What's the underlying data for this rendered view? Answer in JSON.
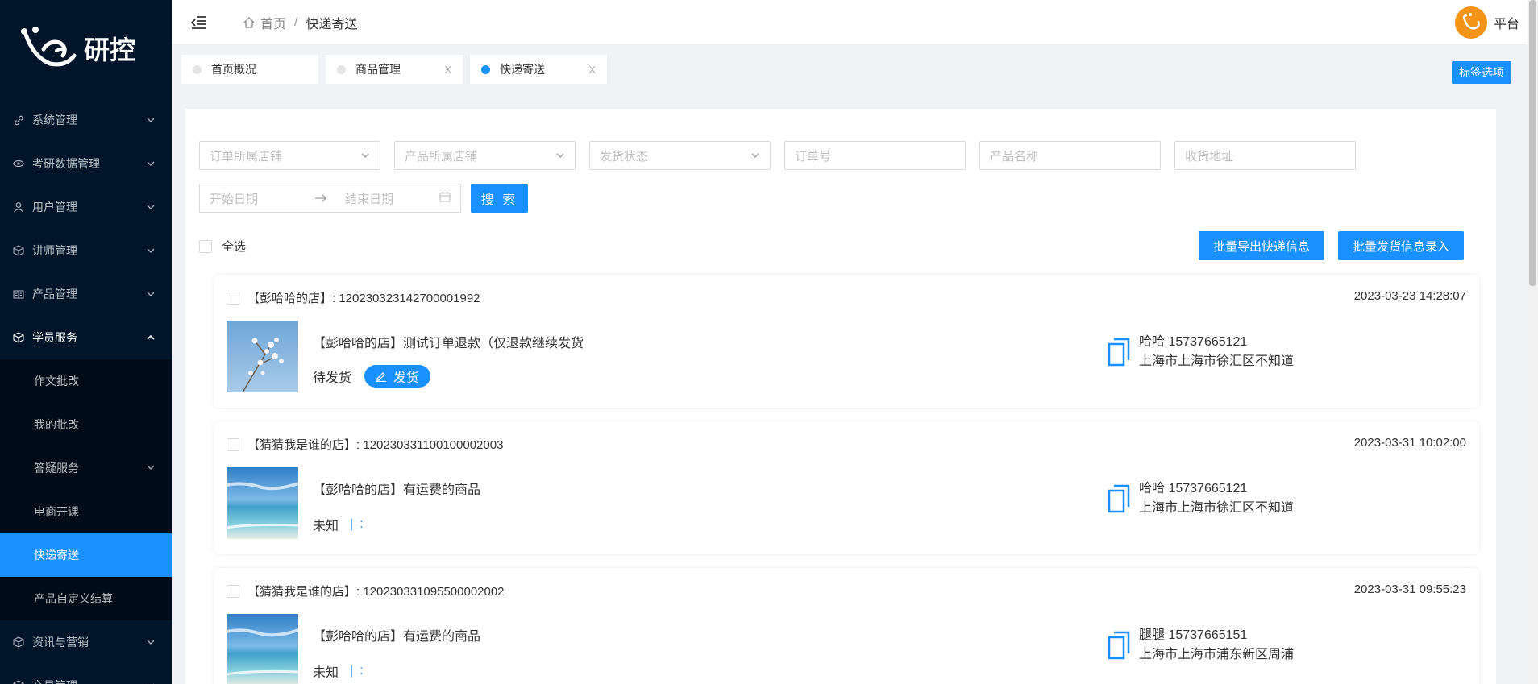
{
  "app": {
    "logo_text": "研控",
    "user_name": "平台"
  },
  "sidebar": {
    "items": [
      {
        "label": "系统管理",
        "icon": "link-icon"
      },
      {
        "label": "考研数据管理",
        "icon": "eye-icon"
      },
      {
        "label": "用户管理",
        "icon": "user-icon"
      },
      {
        "label": "讲师管理",
        "icon": "cube-icon"
      },
      {
        "label": "产品管理",
        "icon": "book-icon"
      },
      {
        "label": "学员服务",
        "icon": "cube-icon"
      }
    ],
    "sub_items": [
      {
        "label": "作文批改"
      },
      {
        "label": "我的批改"
      },
      {
        "label": "答疑服务"
      },
      {
        "label": "电商开课"
      },
      {
        "label": "快递寄送"
      },
      {
        "label": "产品自定义结算"
      }
    ],
    "after_items": [
      {
        "label": "资讯与营销"
      },
      {
        "label": "交易管理"
      }
    ]
  },
  "header": {
    "breadcrumb_home": "首页",
    "breadcrumb_sep": "/",
    "breadcrumb_current": "快递寄送"
  },
  "tags": [
    {
      "label": "首页概况"
    },
    {
      "label": "商品管理",
      "close": "X"
    },
    {
      "label": "快递寄送",
      "close": "X"
    }
  ],
  "tags_option": "标签选项",
  "filters": {
    "shop": "订单所属店铺",
    "product_shop": "产品所属店铺",
    "ship_status": "发货状态",
    "order_no": "订单号",
    "product_name": "产品名称",
    "address": "收货地址",
    "start_date": "开始日期",
    "end_date": "结束日期",
    "search": "搜 索"
  },
  "select_all": "全选",
  "batch": {
    "export": "批量导出快递信息",
    "import": "批量发货信息录入"
  },
  "orders": [
    {
      "head": "【彭哈哈的店】: 120230323142700001992",
      "time": "2023-03-23 14:28:07",
      "product": "【彭哈哈的店】测试订单退款（仅退款继续发货",
      "status": "待发货",
      "action": "发货",
      "contact": "哈哈 15737665121",
      "address": "上海市上海市徐汇区不知道",
      "image": "flower"
    },
    {
      "head": "【猜猜我是谁的店】: 120230331100100002003",
      "time": "2023-03-31 10:02:00",
      "product": "【彭哈哈的店】有运费的商品",
      "status": "未知",
      "pipe": "|",
      "colon": ":",
      "contact": "哈哈 15737665121",
      "address": "上海市上海市徐汇区不知道",
      "image": "beach"
    },
    {
      "head": "【猜猜我是谁的店】: 120230331095500002002",
      "time": "2023-03-31 09:55:23",
      "product": "【彭哈哈的店】有运费的商品",
      "status": "未知",
      "pipe": "|",
      "colon": ":",
      "contact": "腿腿 15737665151",
      "address": "上海市上海市浦东新区周浦",
      "image": "beach"
    }
  ]
}
